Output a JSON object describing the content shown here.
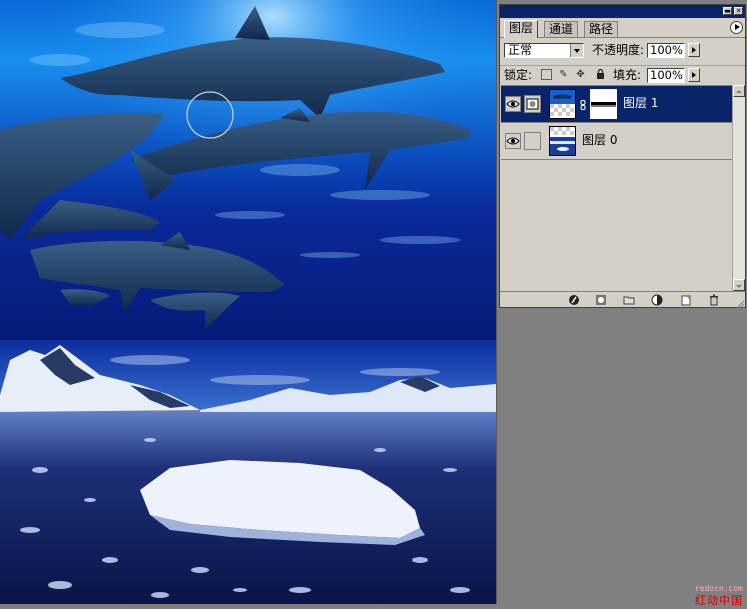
{
  "panel": {
    "tabs": [
      {
        "label": "图层"
      },
      {
        "label": "通道"
      },
      {
        "label": "路径"
      }
    ],
    "blend_mode": "正常",
    "opacity_label": "不透明度:",
    "opacity_value": "100%",
    "lock_label": "锁定:",
    "fill_label": "填充:",
    "fill_value": "100%",
    "layers": [
      {
        "name": "图层 1",
        "selected": true,
        "visible": true
      },
      {
        "name": "图层 0",
        "selected": false,
        "visible": true
      }
    ],
    "bottom_icons": [
      "layer-style-icon",
      "add-mask-icon",
      "new-group-icon",
      "adjustment-layer-icon",
      "new-layer-icon",
      "delete-layer-icon"
    ]
  },
  "canvas": {
    "description_icons": [
      "brush-cursor-icon"
    ]
  },
  "colors": {
    "selection": "#0a246a",
    "panel_bg": "#d4d0c8",
    "workspace": "#808080",
    "watermark": "#d40000"
  },
  "watermark": {
    "url": "redocn.com",
    "name": "红动中国"
  }
}
